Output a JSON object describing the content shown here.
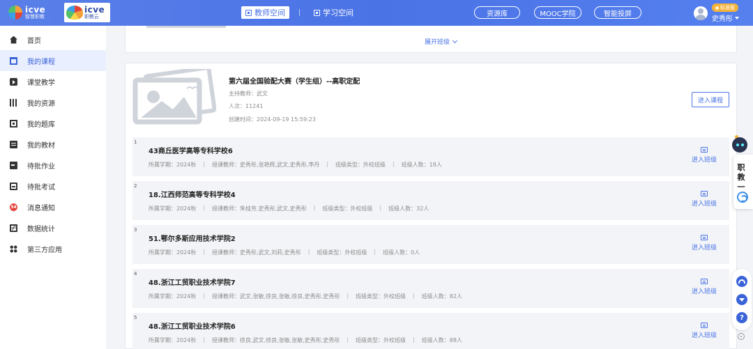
{
  "header": {
    "logo1": {
      "title": "icve",
      "subtitle": "智慧职教"
    },
    "logo2": {
      "title": "icve",
      "subtitle": "职教云"
    },
    "tabs": [
      {
        "label": "教师空间",
        "active": true
      },
      {
        "label": "学习空间",
        "active": false
      }
    ],
    "pills": [
      "资源库",
      "MOOC学院",
      "智能投屏"
    ],
    "user": {
      "badge": "标准版",
      "name": "史秀彤"
    }
  },
  "sidebar": {
    "items": [
      {
        "label": "首页",
        "icon": "home-icon",
        "active": false
      },
      {
        "label": "我的课程",
        "icon": "book-icon",
        "active": true
      },
      {
        "label": "课堂教学",
        "icon": "play-icon",
        "active": false
      },
      {
        "label": "我的资源",
        "icon": "library-icon",
        "active": false
      },
      {
        "label": "我的题库",
        "icon": "question-bank-icon",
        "active": false
      },
      {
        "label": "我的教材",
        "icon": "textbook-icon",
        "active": false
      },
      {
        "label": "待批作业",
        "icon": "homework-icon",
        "active": false
      },
      {
        "label": "待批考试",
        "icon": "exam-icon",
        "active": false
      },
      {
        "label": "消息通知",
        "icon": "message-icon",
        "badge": "54",
        "active": false
      },
      {
        "label": "数据统计",
        "icon": "statistics-icon",
        "active": false
      },
      {
        "label": "第三方应用",
        "icon": "apps-icon",
        "active": false
      }
    ]
  },
  "main": {
    "expand_label": "展开班级",
    "course": {
      "title": "第六届全国验配大赛（学生组）--高职定配",
      "host": "主持教师：武文",
      "count": "人次：11241",
      "created": "创建时间：2024-09-19 15:59:23",
      "enter_label": "进入课程"
    },
    "classes": [
      {
        "num": "1",
        "name": "43商丘医学高等专科学校6",
        "term": "所属学期：2024秋",
        "teachers": "授课教师：史秀彤,张艳辉,武文,史秀彤,李丹",
        "type": "班级类型：外校班级",
        "students": "班级人数：18人"
      },
      {
        "num": "2",
        "name": "18.江西师范高等专科学校4",
        "term": "所属学期：2024秋",
        "teachers": "授课教师：朱桂芳,史秀彤,武文,史秀彤",
        "type": "班级类型：外校班级",
        "students": "班级人数：32人"
      },
      {
        "num": "3",
        "name": "51.鄂尔多斯应用技术学院2",
        "term": "所属学期：2024秋",
        "teachers": "授课教师：史秀彤,武文,刘莉,史秀彤",
        "type": "班级类型：外校班级",
        "students": "班级人数：0人"
      },
      {
        "num": "4",
        "name": "48.浙江工贸职业技术学院7",
        "term": "所属学期：2024秋",
        "teachers": "授课教师：武文,张敏,徐良,张敏,徐良,史秀彤,史秀彤",
        "type": "班级类型：外校班级",
        "students": "班级人数：82人"
      },
      {
        "num": "5",
        "name": "48.浙江工贸职业技术学院6",
        "term": "所属学期：2024秋",
        "teachers": "授课教师：徐良,武文,徐良,张敏,张敏,史秀彤,史秀彤",
        "type": "班级类型：外校班级",
        "students": "班级人数：88人"
      }
    ],
    "enter_class_label": "进入班级"
  },
  "floating": {
    "assistant_label": "职教一",
    "help": "?"
  },
  "colors": {
    "primary": "#4a73e6",
    "header_bg": "#5a7fe8",
    "active_bg": "#e9efff",
    "badge": "#f6b33a"
  }
}
